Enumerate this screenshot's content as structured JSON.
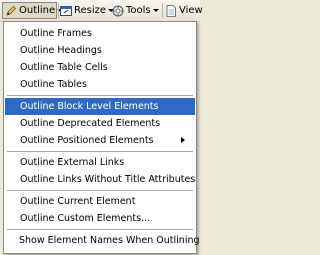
{
  "toolbar": {
    "outline": {
      "label": "Outline",
      "icon": "pencil-icon"
    },
    "resize": {
      "label": "Resize",
      "icon": "resize-window-icon"
    },
    "tools": {
      "label": "Tools",
      "icon": "gear-icon"
    },
    "view": {
      "label": "View",
      "icon": "page-icon"
    }
  },
  "menu": {
    "groups": [
      {
        "items": [
          {
            "label": "Outline Frames"
          },
          {
            "label": "Outline Headings"
          },
          {
            "label": "Outline Table Cells"
          },
          {
            "label": "Outline Tables"
          }
        ]
      },
      {
        "items": [
          {
            "label": "Outline Block Level Elements",
            "highlighted": true
          },
          {
            "label": "Outline Deprecated Elements"
          },
          {
            "label": "Outline Positioned Elements",
            "submenu": true
          }
        ]
      },
      {
        "items": [
          {
            "label": "Outline External Links"
          },
          {
            "label": "Outline Links Without Title Attributes"
          }
        ]
      },
      {
        "items": [
          {
            "label": "Outline Current Element"
          },
          {
            "label": "Outline Custom Elements..."
          }
        ]
      },
      {
        "items": [
          {
            "label": "Show Element Names When Outlining"
          }
        ]
      }
    ]
  },
  "colors": {
    "highlight": "#316ac5",
    "menu_bg": "#ffffff",
    "toolbar_bg": "#ece9d8"
  }
}
